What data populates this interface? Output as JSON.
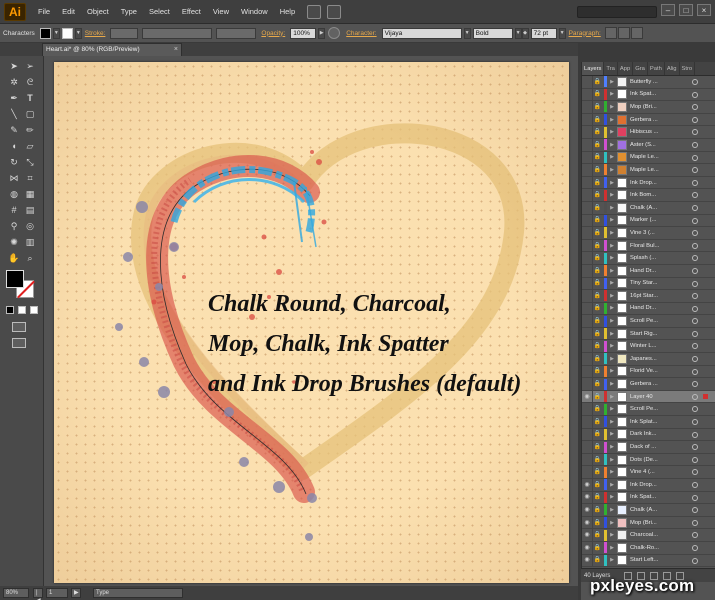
{
  "app": {
    "logo": "Ai",
    "menu": [
      "File",
      "Edit",
      "Object",
      "Type",
      "Select",
      "Effect",
      "View",
      "Window",
      "Help"
    ]
  },
  "controlbar": {
    "panel_label": "Characters",
    "stroke_label": "Stroke:",
    "opacity_label": "Opacity:",
    "opacity_value": "100%",
    "character_label": "Character:",
    "font_family": "Vijaya",
    "font_style": "Bold",
    "font_size": "72 pt",
    "paragraph_label": "Paragraph:"
  },
  "document": {
    "tab_title": "Heart.ai* @ 80% (RGB/Preview)",
    "caption_lines": [
      "Chalk Round, Charcoal,",
      "Mop, Chalk, Ink Spatter",
      "and Ink Drop Brushes (default)"
    ]
  },
  "statusbar": {
    "zoom": "80%",
    "artboard": "1",
    "tool": "Type"
  },
  "layers_panel": {
    "tabs": [
      "Layers",
      "Tra",
      "App",
      "Gra",
      "Path",
      "Alig",
      "Stro"
    ],
    "active_tab": "Layers",
    "count_label": "40 Layers",
    "layers": [
      {
        "name": "Butterfly ...",
        "color": "#4f7fff",
        "thumb": "#f3f3f3"
      },
      {
        "name": "Ink Spat...",
        "color": "#d03030",
        "thumb": "#ffffff"
      },
      {
        "name": "Mop (Bri...",
        "color": "#30b030",
        "thumb": "#f0d0c0"
      },
      {
        "name": "Gerbera ...",
        "color": "#3050e0",
        "thumb": "#e07030"
      },
      {
        "name": "Hibiscus ...",
        "color": "#e0c030",
        "thumb": "#e04060"
      },
      {
        "name": "Aster (S...",
        "color": "#d050d0",
        "thumb": "#a070e0"
      },
      {
        "name": "Maple Le...",
        "color": "#30c0c0",
        "thumb": "#e09030"
      },
      {
        "name": "Maple Le...",
        "color": "#f08030",
        "thumb": "#d08030"
      },
      {
        "name": "Ink Drop...",
        "color": "#4060f0",
        "thumb": "#ffffff"
      },
      {
        "name": "Ink Bom...",
        "color": "#d03030",
        "thumb": "#ffffff"
      },
      {
        "name": "Chalk (A...",
        "color": "#505050",
        "thumb": "#f8f8f8"
      },
      {
        "name": "Marker (...",
        "color": "#3050e0",
        "thumb": "#ffffff"
      },
      {
        "name": "Vine 3 (...",
        "color": "#e0c030",
        "thumb": "#ffffff"
      },
      {
        "name": "Floral Bul...",
        "color": "#d050d0",
        "thumb": "#ffffff"
      },
      {
        "name": "Splash (...",
        "color": "#30c0c0",
        "thumb": "#ffffff"
      },
      {
        "name": "Hand Dr...",
        "color": "#f08030",
        "thumb": "#ffffff"
      },
      {
        "name": "Tiny Star...",
        "color": "#4060f0",
        "thumb": "#ffffff"
      },
      {
        "name": "16pt Star...",
        "color": "#d03030",
        "thumb": "#ffffff"
      },
      {
        "name": "Hand Dr...",
        "color": "#30b030",
        "thumb": "#ffffff"
      },
      {
        "name": "Scroll Pe...",
        "color": "#3050e0",
        "thumb": "#ffffff"
      },
      {
        "name": "Start Rig...",
        "color": "#e0c030",
        "thumb": "#ffffff"
      },
      {
        "name": "Winter L...",
        "color": "#d050d0",
        "thumb": "#ffffff"
      },
      {
        "name": "Japanes...",
        "color": "#30c0c0",
        "thumb": "#f0e8c0"
      },
      {
        "name": "Florid Ve...",
        "color": "#f08030",
        "thumb": "#ffffff"
      },
      {
        "name": "Gerbera ...",
        "color": "#4060f0",
        "thumb": "#ffffff"
      },
      {
        "name": "Layer 40",
        "color": "#d03030",
        "thumb": "#ffffff",
        "selected": true
      },
      {
        "name": "Scroll Pe...",
        "color": "#30b030",
        "thumb": "#ffffff"
      },
      {
        "name": "Ink Splat...",
        "color": "#3050e0",
        "thumb": "#ffffff"
      },
      {
        "name": "Dark Ink...",
        "color": "#e0c030",
        "thumb": "#ffffff"
      },
      {
        "name": "Dack of ...",
        "color": "#d050d0",
        "thumb": "#ffffff"
      },
      {
        "name": "Dots (De...",
        "color": "#30c0c0",
        "thumb": "#ffffff"
      },
      {
        "name": "Vine 4 (...",
        "color": "#f08030",
        "thumb": "#ffffff"
      },
      {
        "name": "Ink Drop...",
        "color": "#4060f0",
        "thumb": "#ffffff",
        "visible": true
      },
      {
        "name": "Ink Spat...",
        "color": "#d03030",
        "thumb": "#ffffff",
        "visible": true
      },
      {
        "name": "Chalk (A...",
        "color": "#30b030",
        "thumb": "#e8f0ff",
        "visible": true
      },
      {
        "name": "Mop (Bri...",
        "color": "#3050e0",
        "thumb": "#f0c0c0",
        "visible": true
      },
      {
        "name": "Charcoal...",
        "color": "#e0c030",
        "thumb": "#f0f0f0",
        "visible": true
      },
      {
        "name": "Chalk-Ro...",
        "color": "#d050d0",
        "thumb": "#ffffff",
        "visible": true
      },
      {
        "name": "Start Left...",
        "color": "#30c0c0",
        "thumb": "#ffffff",
        "visible": true
      }
    ]
  },
  "watermark": "pxleyes.com",
  "colors": {
    "artboard": "#fbe0b0",
    "heart_outline": "#e6c27a",
    "chalk_red": "#d9534a",
    "spatter_blue": "#2fa7e0",
    "ink_drop": "#8a86a8"
  }
}
